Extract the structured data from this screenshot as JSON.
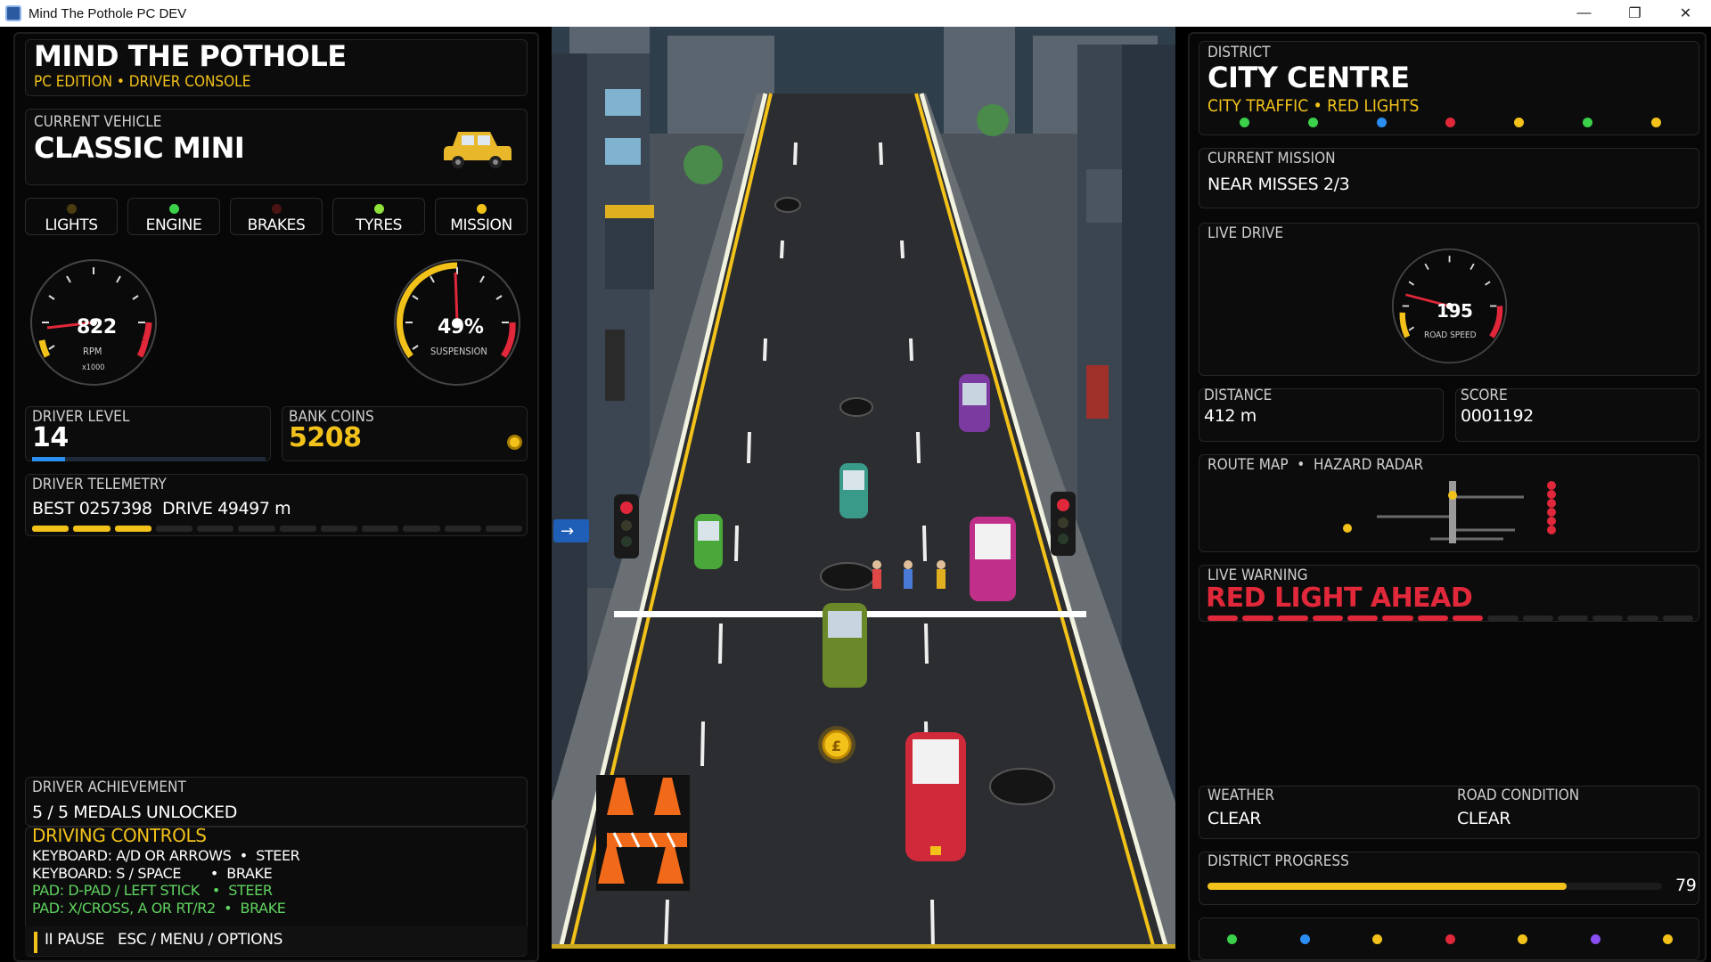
{
  "window": {
    "title": "Mind The Pothole PC DEV",
    "min": "—",
    "restore": "❐",
    "close": "✕"
  },
  "left": {
    "title": "MIND THE POTHOLE",
    "subtitle": "PC EDITION  •  DRIVER CONSOLE",
    "vehicle_label": "CURRENT VEHICLE",
    "vehicle_name": "CLASSIC MINI",
    "status": [
      {
        "label": "LIGHTS",
        "color": "#4a3b10"
      },
      {
        "label": "ENGINE",
        "color": "#3bd14a"
      },
      {
        "label": "BRAKES",
        "color": "#4a1414"
      },
      {
        "label": "TYRES",
        "color": "#8ee23a"
      },
      {
        "label": "MISSION",
        "color": "#f2c21a"
      }
    ],
    "rpm_gauge": {
      "value": "822",
      "label": "RPM",
      "sublabel": "x1000"
    },
    "susp_gauge": {
      "value": "49%",
      "label": "SUSPENSION"
    },
    "driver_level_label": "DRIVER LEVEL",
    "driver_level": "14",
    "driver_level_progress": 0.14,
    "bank_coins_label": "BANK COINS",
    "bank_coins": "5208",
    "telemetry_label": "DRIVER TELEMETRY",
    "best": "BEST 0257398",
    "drive": "DRIVE 49497 m",
    "telemetry_segments_lit": 3,
    "telemetry_segments_total": 12,
    "achievement_label": "DRIVER ACHIEVEMENT",
    "achievement": "5 / 5 MEDALS UNLOCKED",
    "controls_title": "DRIVING CONTROLS",
    "controls": [
      {
        "text": "KEYBOARD: A/D OR ARROWS  •  STEER",
        "color": "#ffffff"
      },
      {
        "text": "KEYBOARD: S / SPACE       •  BRAKE",
        "color": "#ffffff"
      },
      {
        "text": "PAD: D-PAD / LEFT STICK   •  STEER",
        "color": "#5fd35f"
      },
      {
        "text": "PAD: X/CROSS, A OR RT/R2  •  BRAKE",
        "color": "#5fd35f"
      }
    ],
    "pause_hint": "II PAUSE   ESC / MENU / OPTIONS"
  },
  "right": {
    "district_label": "DISTRICT",
    "district": "CITY CENTRE",
    "district_sub": "CITY TRAFFIC • RED LIGHTS",
    "district_dots": [
      "#3bd14a",
      "#3bd14a",
      "#2a8ef2",
      "#e0283a",
      "#f2c21a",
      "#3bd14a",
      "#f2c21a"
    ],
    "mission_label": "CURRENT MISSION",
    "mission": "NEAR MISSES 2/3",
    "live_drive_label": "LIVE DRIVE",
    "speed_gauge": {
      "value": "195",
      "label": "ROAD SPEED"
    },
    "distance_label": "DISTANCE",
    "distance": "412 m",
    "score_label": "SCORE",
    "score": "0001192",
    "map_label": "ROUTE MAP  •  HAZARD RADAR",
    "warning_label": "LIVE WARNING",
    "warning": "RED LIGHT AHEAD",
    "warning_segments_lit": 8,
    "warning_segments_total": 14,
    "weather_label": "WEATHER",
    "weather": "CLEAR",
    "road_label": "ROAD CONDITION",
    "road": "CLEAR",
    "progress_label": "DISTRICT PROGRESS",
    "progress_value": "79",
    "progress": 0.79,
    "bottom_dots": [
      "#3bd14a",
      "#2a8ef2",
      "#f2c21a",
      "#e0283a",
      "#f2c21a",
      "#8a4ef2",
      "#f2c21a"
    ]
  },
  "colors": {
    "accent": "#f2c21a",
    "warning": "#e0283a",
    "panel": "#070707"
  }
}
